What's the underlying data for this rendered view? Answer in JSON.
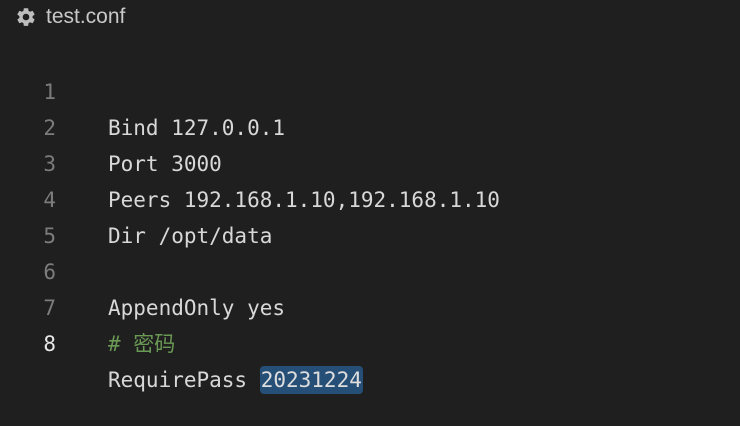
{
  "file": {
    "title": "test.conf",
    "icon": "gear-icon"
  },
  "editor": {
    "lines": [
      {
        "number": "1",
        "text": "Bind 127.0.0.1"
      },
      {
        "number": "2",
        "text": "Port 3000"
      },
      {
        "number": "3",
        "text": "Peers 192.168.1.10,192.168.1.10"
      },
      {
        "number": "4",
        "text": "Dir /opt/data"
      },
      {
        "number": "5",
        "text": ""
      },
      {
        "number": "6",
        "text": "AppendOnly yes"
      },
      {
        "number": "7",
        "text": "# 密码"
      },
      {
        "number": "8",
        "key": "RequirePass ",
        "selected_value": "20231224"
      }
    ],
    "active_line": "8",
    "colors": {
      "background": "#1f1f1f",
      "text": "#d8d8d8",
      "line_number": "#7c7c7c",
      "active_line_number": "#e8e8e8",
      "comment": "#6a9955",
      "selection": "#264f78"
    }
  }
}
